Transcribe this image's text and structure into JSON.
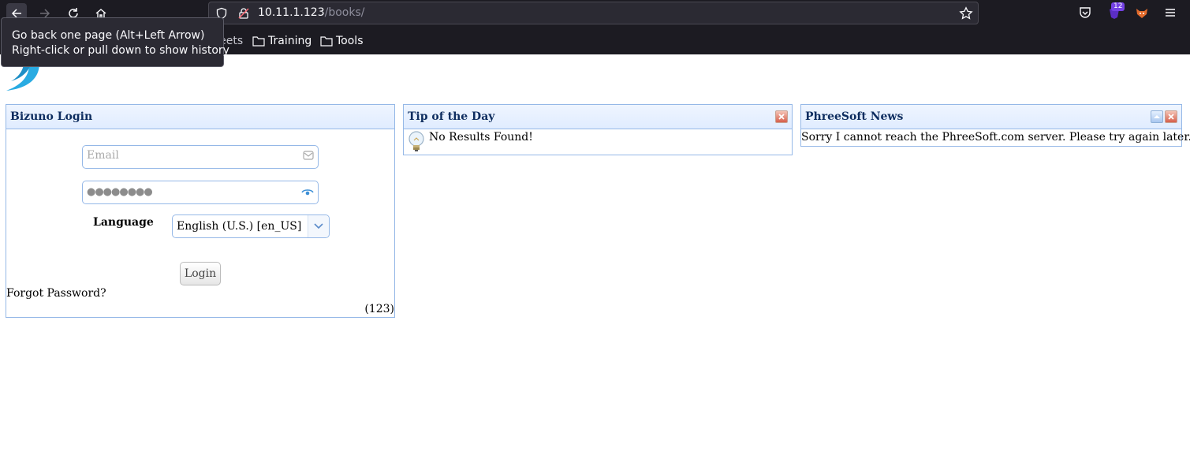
{
  "browser": {
    "url_host": "10.11.1.123",
    "url_path": "/books/",
    "extension_badge": "12",
    "bookmarks": {
      "cheat_sheets": "heat sheets",
      "training": "Training",
      "tools": "Tools"
    },
    "tooltip": {
      "line1": "Go back one page (Alt+Left Arrow)",
      "line2": "Right-click or pull down to show history"
    }
  },
  "login": {
    "title": "Bizuno Login",
    "email_placeholder": "Email",
    "password_dots": "●●●●●●●●",
    "language_label": "Language",
    "language_value": "English (U.S.) [en_US]",
    "login_button": "Login",
    "forgot_password": "Forgot Password?",
    "version": "(123)"
  },
  "tip": {
    "title": "Tip of the Day",
    "text": "No Results Found!"
  },
  "news": {
    "title": "PhreeSoft News",
    "text": "Sorry I cannot reach the PhreeSoft.com server. Please try again later."
  },
  "colors": {
    "chrome_bg": "#1c1b22",
    "panel_border": "#95b8e7",
    "panel_title": "#0e2d5f",
    "logo": "#29abe2"
  }
}
